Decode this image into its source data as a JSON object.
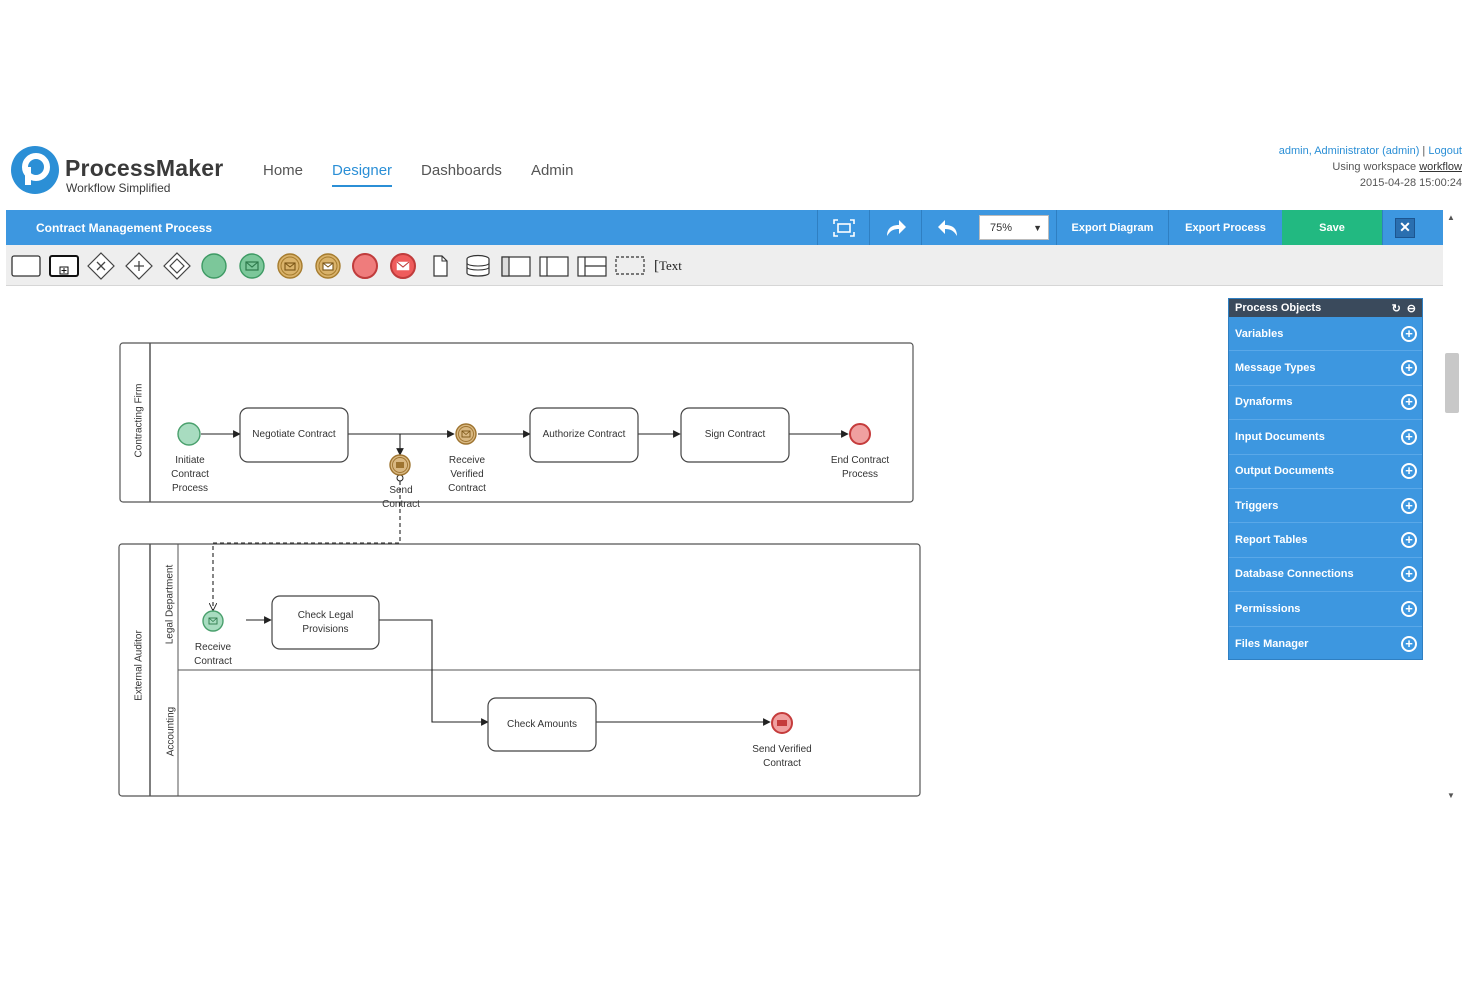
{
  "app": {
    "name": "ProcessMaker",
    "tagline": "Workflow Simplified"
  },
  "nav": [
    {
      "label": "Home"
    },
    {
      "label": "Designer"
    },
    {
      "label": "Dashboards"
    },
    {
      "label": "Admin"
    }
  ],
  "user": {
    "name": "admin, Administrator (admin)",
    "separator": "|",
    "logout": "Logout",
    "workspace_prefix": "Using workspace",
    "workspace": "workflow",
    "datetime": "2015-04-28 15:00:24"
  },
  "toolbar": {
    "process_title": "Contract Management Process",
    "zoom": "75%",
    "export_diagram": "Export Diagram",
    "export_process": "Export Process",
    "save": "Save"
  },
  "palette": {
    "text_tool": "Text"
  },
  "process_objects": {
    "title": "Process Objects",
    "items": [
      {
        "label": "Variables"
      },
      {
        "label": "Message Types"
      },
      {
        "label": "Dynaforms"
      },
      {
        "label": "Input Documents"
      },
      {
        "label": "Output Documents"
      },
      {
        "label": "Triggers"
      },
      {
        "label": "Report Tables"
      },
      {
        "label": "Database Connections"
      },
      {
        "label": "Permissions"
      },
      {
        "label": "Files Manager"
      }
    ]
  },
  "diagram": {
    "pool1": "Contracting Firm",
    "pool2": "External Auditor",
    "lane_legal": "Legal Department",
    "lane_accounting": "Accounting",
    "tasks": {
      "negotiate": "Negotiate Contract",
      "authorize": "Authorize Contract",
      "sign": "Sign Contract",
      "check_legal": "Check Legal Provisions",
      "check_amounts": "Check Amounts"
    },
    "events": {
      "initiate": "Initiate Contract Process",
      "send_contract": "Send Contract",
      "receive_verified": "Receive Verified Contract",
      "end_contract": "End Contract Process",
      "receive_contract": "Receive Contract",
      "send_verified": "Send Verified Contract"
    }
  },
  "colors": {
    "primary": "#3d97e0",
    "save": "#22b981",
    "start_event": "#a8dcc0",
    "intermediate_event": "#d9b882",
    "end_event": "#f0a0a0"
  }
}
